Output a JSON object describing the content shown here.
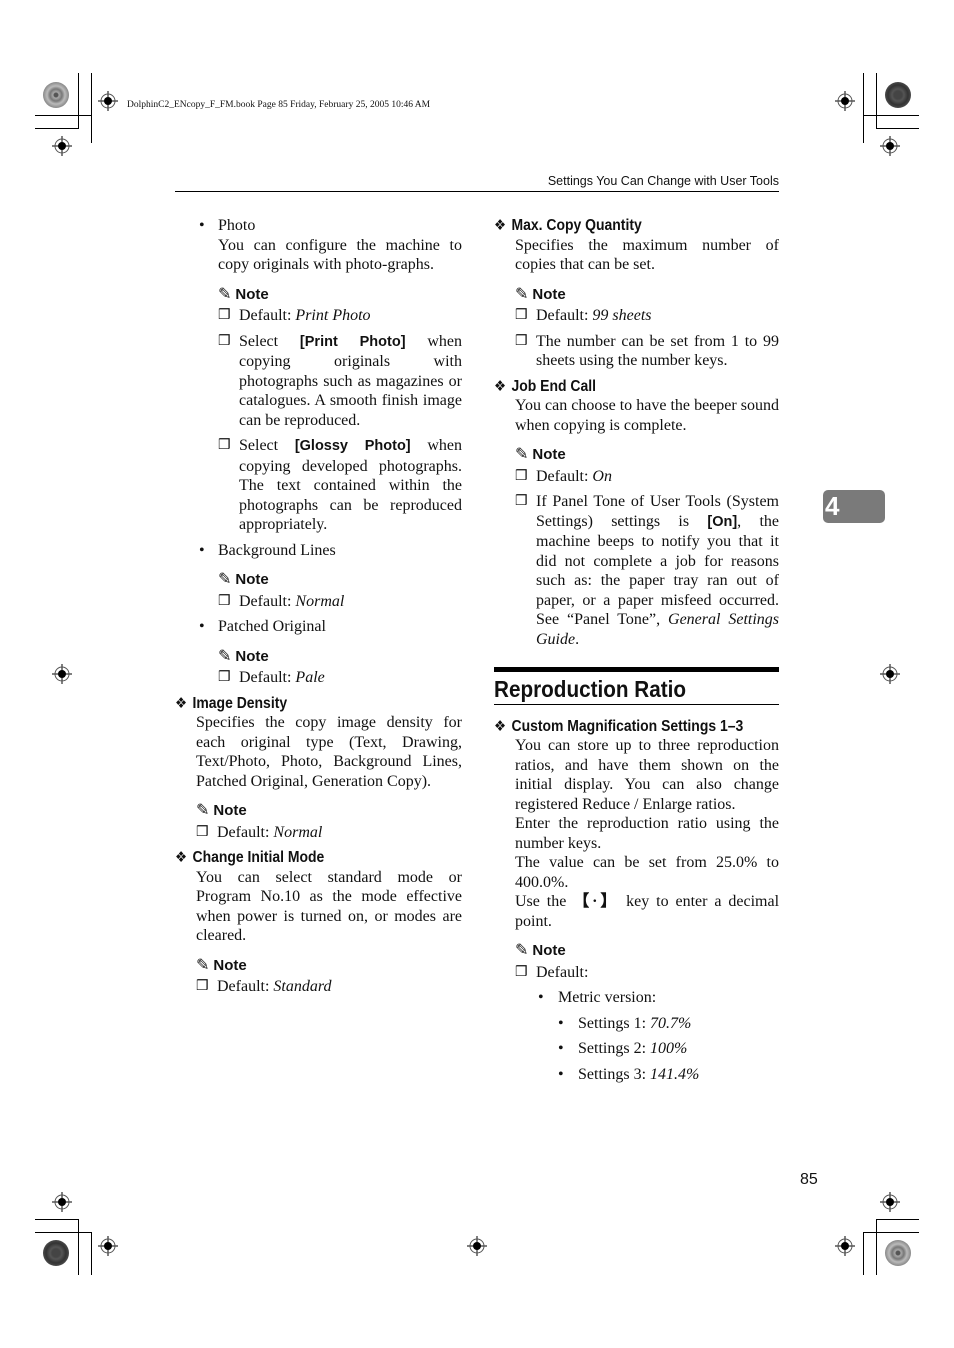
{
  "file_info": "DolphinC2_ENcopy_F_FM.book  Page 85  Friday, February 25, 2005  10:46 AM",
  "running_head": "Settings You Can Change with User Tools",
  "chapter_tab": "4",
  "page_number": "85",
  "icons": {
    "note": "pencil-icon",
    "checkbox": "checkbox-icon",
    "diamond": "diamond-bullet-icon",
    "bullet": "bullet-icon"
  },
  "left_column": {
    "photo": {
      "title": "Photo",
      "desc": "You can configure the machine to copy originals with photo-graphs.",
      "note_label": "Note",
      "notes": [
        {
          "prefix": "Default: ",
          "value": "Print Photo"
        },
        {
          "before": "Select ",
          "ui": "[Print Photo]",
          "after": " when copying originals with photographs such as magazines or catalogues. A smooth finish image can be reproduced."
        },
        {
          "before": "Select ",
          "ui": "[Glossy Photo]",
          "after": " when copying developed photographs. The text contained within the photographs can be reproduced appropriately."
        }
      ]
    },
    "background_lines": {
      "title": "Background Lines",
      "note_label": "Note",
      "default_prefix": "Default: ",
      "default_value": "Normal"
    },
    "patched_original": {
      "title": "Patched Original",
      "note_label": "Note",
      "default_prefix": "Default: ",
      "default_value": "Pale"
    },
    "image_density": {
      "title": "Image Density",
      "desc": "Specifies the copy image density for each original type (Text, Drawing, Text/Photo, Photo, Background Lines, Patched Original, Generation Copy).",
      "note_label": "Note",
      "default_prefix": "Default: ",
      "default_value": "Normal"
    },
    "change_initial_mode": {
      "title": "Change Initial Mode",
      "desc": "You can select standard mode or Program No.10 as the mode effective when power is turned on, or modes are cleared.",
      "note_label": "Note",
      "default_prefix": "Default: ",
      "default_value": "Standard"
    }
  },
  "right_column": {
    "max_copy_quantity": {
      "title": "Max. Copy Quantity",
      "desc": "Specifies the maximum number of copies that can be set.",
      "note_label": "Note",
      "default_prefix": "Default: ",
      "default_value": "99 sheets",
      "note2": "The number can be set from 1 to 99 sheets using the number keys."
    },
    "job_end_call": {
      "title": "Job End Call",
      "desc": "You can choose to have the beeper sound when copying is complete.",
      "note_label": "Note",
      "default_prefix": "Default: ",
      "default_value": "On",
      "note2_before": "If Panel Tone of User Tools (System Settings) settings is ",
      "note2_ui": "[On]",
      "note2_after": ", the machine beeps to notify you that it did not complete a job for reasons such as: the paper tray ran out of paper, or a paper misfeed occurred. See “Panel Tone”, ",
      "note2_ref": "General Settings Guide",
      "note2_end": "."
    },
    "reproduction_ratio": {
      "heading": "Reproduction Ratio",
      "custom": {
        "title": "Custom Magnification Settings 1–3",
        "desc1": "You can store up to three reproduction ratios, and have them shown on the initial display. You can also change registered Reduce / Enlarge ratios.",
        "desc2": "Enter the reproduction ratio using the number keys.",
        "desc3": "The value can be set from 25.0% to 400.0%.",
        "desc4_before": "Use the ",
        "desc4_key": "【·】",
        "desc4_after": " key to enter a decimal point.",
        "note_label": "Note",
        "default_label": "Default:",
        "version": "Metric version:",
        "settings": [
          {
            "label": "Settings 1: ",
            "value": "70.7%"
          },
          {
            "label": "Settings 2: ",
            "value": "100%"
          },
          {
            "label": "Settings 3: ",
            "value": "141.4%"
          }
        ]
      }
    }
  }
}
